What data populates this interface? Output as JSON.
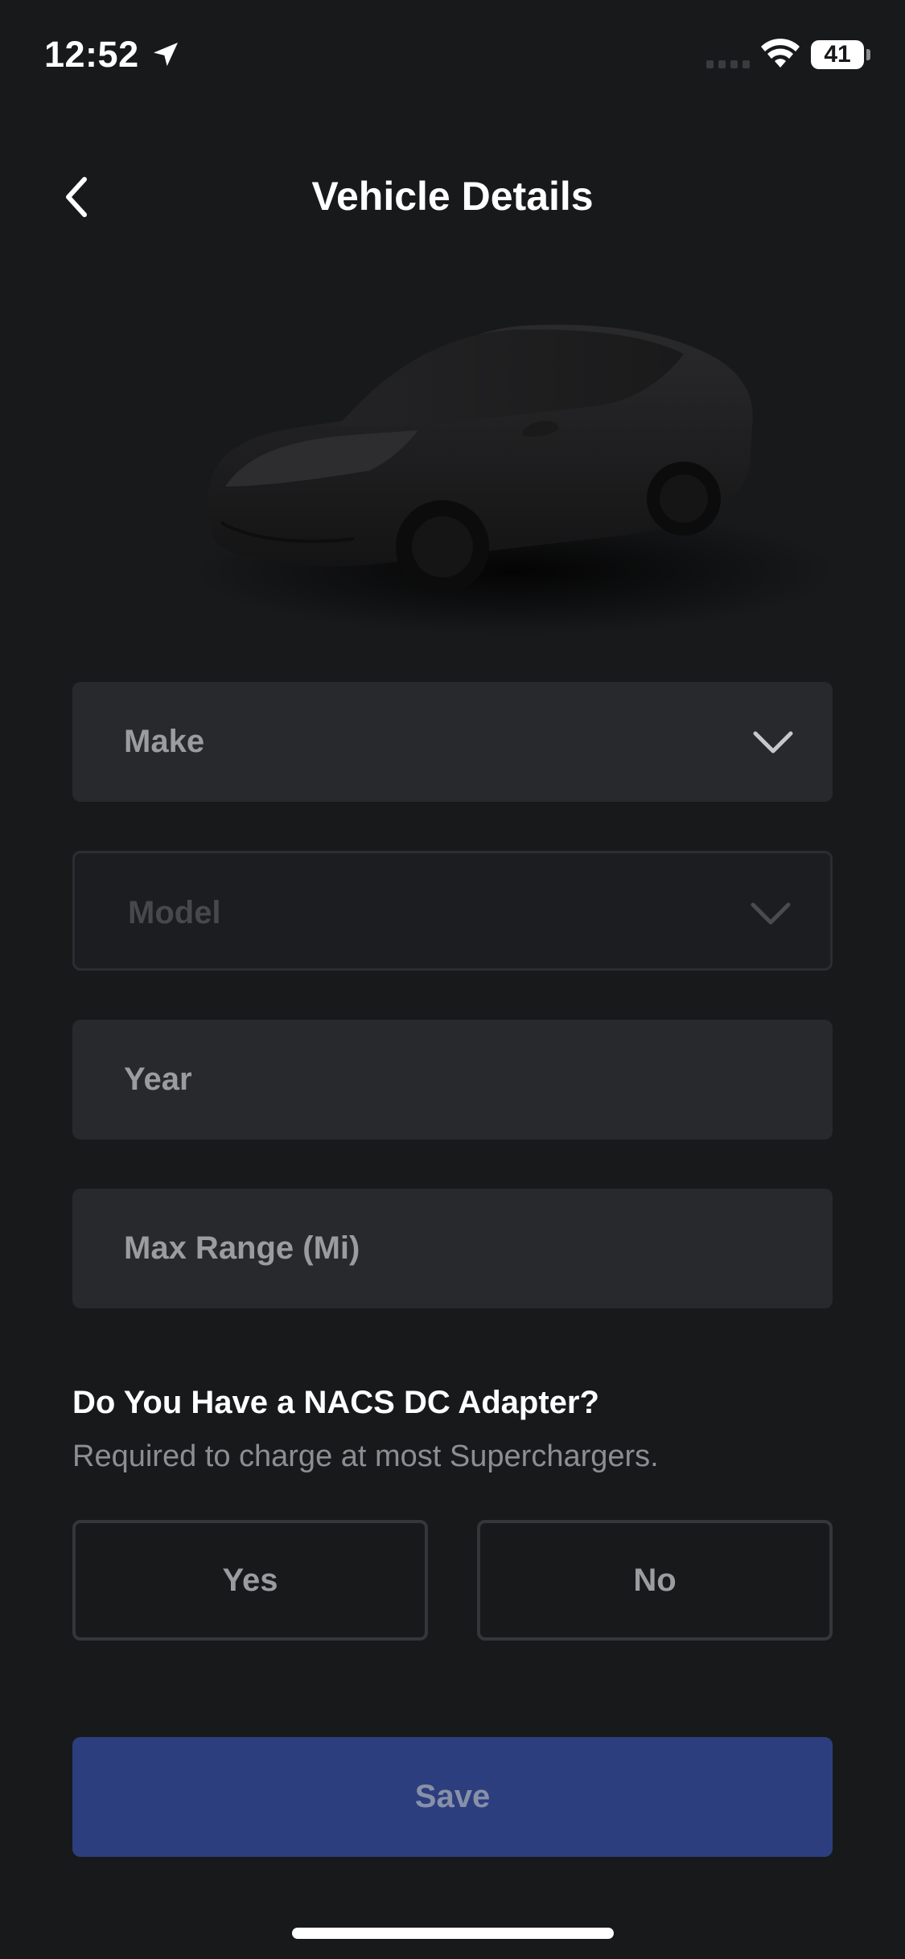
{
  "status_bar": {
    "time": "12:52",
    "battery": "41",
    "battery_level": 0.41,
    "icons": [
      "location-arrow-icon",
      "cellular-signal-icon",
      "wifi-icon",
      "battery-icon"
    ]
  },
  "header": {
    "title": "Vehicle Details",
    "back_icon": "chevron-left-icon"
  },
  "vehicle_image": {
    "icon": "car-silhouette"
  },
  "form": {
    "make": {
      "placeholder": "Make",
      "icon": "chevron-down-icon"
    },
    "model": {
      "placeholder": "Model",
      "icon": "chevron-down-icon",
      "disabled": true
    },
    "year": {
      "placeholder": "Year"
    },
    "max_range": {
      "placeholder": "Max Range (Mi)"
    }
  },
  "nacs": {
    "question": "Do You Have a NACS DC Adapter?",
    "subtitle": "Required to charge at most Superchargers.",
    "yes_label": "Yes",
    "no_label": "No"
  },
  "actions": {
    "save_label": "Save"
  },
  "colors": {
    "background": "#18191b",
    "field": "#28292c",
    "save_button": "#2c3e7e",
    "text_muted": "#9b9ca0"
  }
}
